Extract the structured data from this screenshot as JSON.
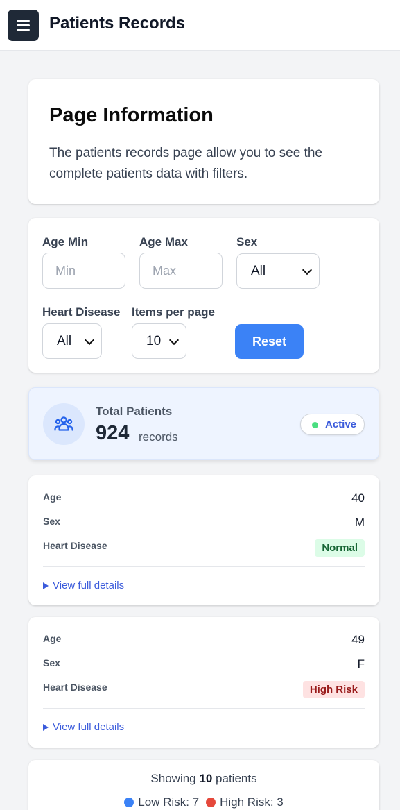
{
  "header": {
    "title": "Patients Records",
    "menu_icon": "hamburger-menu-icon"
  },
  "info": {
    "title": "Page Information",
    "text": "The patients records page allow you to see the complete patients data with filters."
  },
  "filters": {
    "age_min_label": "Age Min",
    "age_min_placeholder": "Min",
    "age_max_label": "Age Max",
    "age_max_placeholder": "Max",
    "sex_label": "Sex",
    "sex_value": "All",
    "heart_label": "Heart Disease",
    "heart_value": "All",
    "per_page_label": "Items per page",
    "per_page_value": "10",
    "reset_label": "Reset"
  },
  "total": {
    "label": "Total Patients",
    "count": "924",
    "unit": "records",
    "status": "Active",
    "icon": "users-icon",
    "colors": {
      "accent": "#3b82f6",
      "active_dot": "#4ade80"
    }
  },
  "patients": [
    {
      "age_label": "Age",
      "age": "40",
      "sex_label": "Sex",
      "sex": "M",
      "heart_label": "Heart Disease",
      "heart": "Normal",
      "details": "View full details"
    },
    {
      "age_label": "Age",
      "age": "49",
      "sex_label": "Sex",
      "sex": "F",
      "heart_label": "Heart Disease",
      "heart": "High Risk",
      "details": "View full details"
    }
  ],
  "summary": {
    "showing_prefix": "Showing",
    "showing_count": "10",
    "showing_suffix": "patients",
    "low_risk": "Low Risk: 7",
    "high_risk": "High Risk: 3",
    "colors": {
      "low": "#3b82f6",
      "high": "#e5483b"
    }
  }
}
